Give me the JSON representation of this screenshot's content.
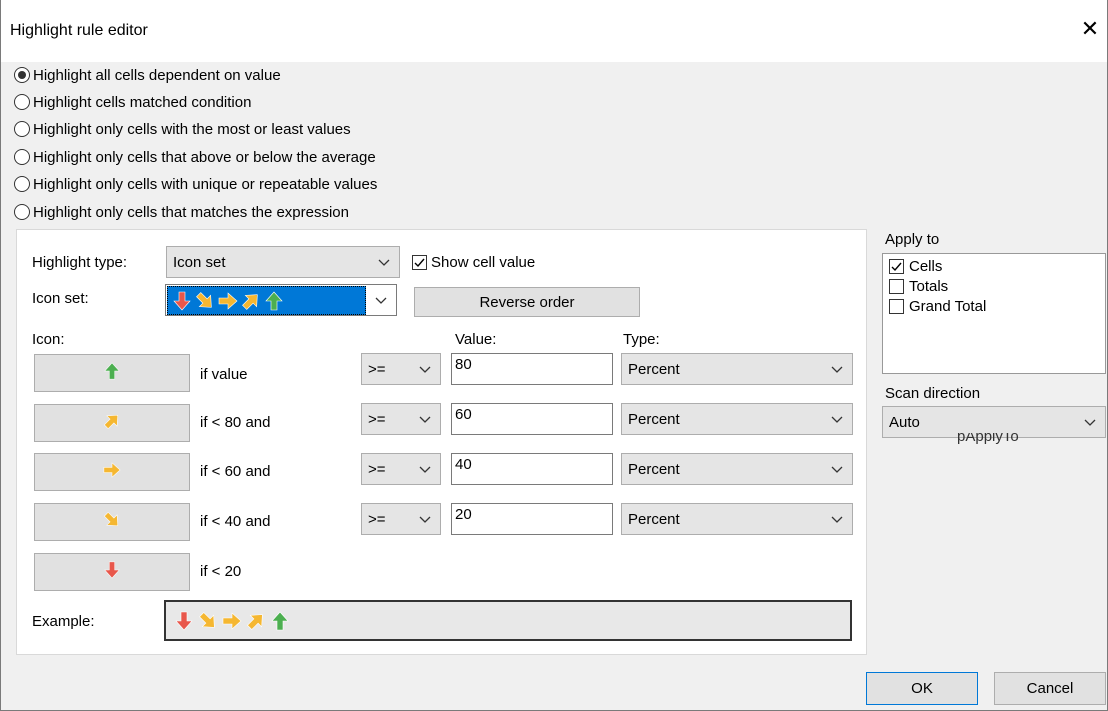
{
  "window": {
    "title": "Highlight rule editor",
    "close": "✕"
  },
  "modes": [
    {
      "label": "Highlight all cells dependent on value",
      "checked": true
    },
    {
      "label": "Highlight cells matched condition",
      "checked": false
    },
    {
      "label": "Highlight only cells with the most or least values",
      "checked": false
    },
    {
      "label": "Highlight only cells that above or below the average",
      "checked": false
    },
    {
      "label": "Highlight only cells with unique or repeatable values",
      "checked": false
    },
    {
      "label": "Highlight only cells that matches the expression",
      "checked": false
    }
  ],
  "highlight_type": {
    "label": "Highlight type:",
    "value": "Icon set"
  },
  "show_cell_value": {
    "label": "Show cell value",
    "checked": true
  },
  "icon_set": {
    "label": "Icon set:",
    "icons": [
      "arrow-down-red-icon",
      "arrow-down-right-yellow-icon",
      "arrow-right-yellow-icon",
      "arrow-up-right-yellow-icon",
      "arrow-up-green-icon"
    ]
  },
  "reverse_order": "Reverse order",
  "headers": {
    "icon": "Icon:",
    "value": "Value:",
    "type": "Type:"
  },
  "rules": [
    {
      "icon": "arrow-up-green-icon",
      "condition": "if value",
      "operator": ">=",
      "value": "80",
      "type": "Percent"
    },
    {
      "icon": "arrow-up-right-yellow-icon",
      "condition": "if < 80 and",
      "operator": ">=",
      "value": "60",
      "type": "Percent"
    },
    {
      "icon": "arrow-right-yellow-icon",
      "condition": "if < 60 and",
      "operator": ">=",
      "value": "40",
      "type": "Percent"
    },
    {
      "icon": "arrow-down-right-yellow-icon",
      "condition": "if < 40 and",
      "operator": ">=",
      "value": "20",
      "type": "Percent"
    },
    {
      "icon": "arrow-down-red-icon",
      "condition": "if < 20"
    }
  ],
  "example": {
    "label": "Example:",
    "icons": [
      "arrow-down-red-icon",
      "arrow-down-right-yellow-icon",
      "arrow-right-yellow-icon",
      "arrow-up-right-yellow-icon",
      "arrow-up-green-icon"
    ]
  },
  "apply_to": {
    "label": "Apply to",
    "items": [
      {
        "label": "Cells",
        "checked": true
      },
      {
        "label": "Totals",
        "checked": false
      },
      {
        "label": "Grand Total",
        "checked": false
      }
    ]
  },
  "scan_direction": {
    "label": "Scan direction",
    "value": "Auto"
  },
  "ghost_label": "pApplyTo",
  "buttons": {
    "ok": "OK",
    "cancel": "Cancel"
  },
  "colors": {
    "red": "#e8574b",
    "yellow": "#f5b731",
    "green": "#4caf50",
    "accent": "#0078d7"
  }
}
